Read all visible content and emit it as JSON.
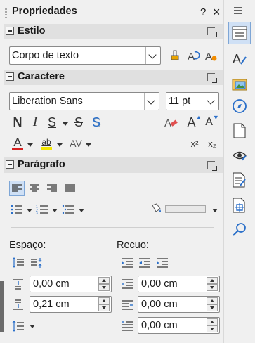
{
  "panel": {
    "title": "Propriedades",
    "help_label": "?",
    "close_label": "×"
  },
  "estilo": {
    "header": "Estilo",
    "style_value": "Corpo de texto"
  },
  "caractere": {
    "header": "Caractere",
    "font_value": "Liberation Sans",
    "size_value": "11 pt",
    "bold": "N",
    "italic": "I",
    "underline": "S",
    "strike": "S",
    "shadow": "S",
    "grow": "A",
    "shrink": "A",
    "font_color": "A",
    "highlight": "ab",
    "spacing": "AV",
    "superscript": "x²",
    "subscript": "x₂"
  },
  "paragrafo": {
    "header": "Parágrafo",
    "espaco_label": "Espaço:",
    "recuo_label": "Recuo:",
    "above_value": "0,00 cm",
    "below_value": "0,21 cm",
    "indent_before_value": "0,00 cm",
    "indent_after_value": "0,00 cm",
    "first_line_value": "0,00 cm"
  },
  "colors": {
    "accent": "#2a6fc9",
    "font_color": "#d62020",
    "highlight": "#f2e600"
  }
}
